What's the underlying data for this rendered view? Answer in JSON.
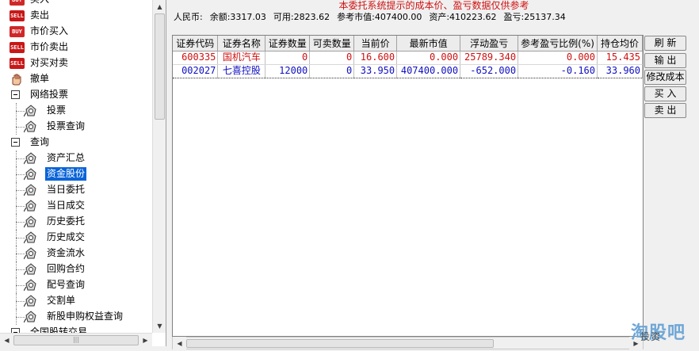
{
  "tree": {
    "items": [
      {
        "label": "买入",
        "icon": "buy-icon",
        "type": "trade"
      },
      {
        "label": "卖出",
        "icon": "sell-icon",
        "type": "trade"
      },
      {
        "label": "市价买入",
        "icon": "buy-icon",
        "type": "trade"
      },
      {
        "label": "市价卖出",
        "icon": "sell-icon",
        "type": "trade"
      },
      {
        "label": "对买对卖",
        "icon": "sell-icon",
        "type": "trade"
      },
      {
        "label": "撤单",
        "icon": "hand-icon",
        "type": "trade"
      },
      {
        "label": "网络投票",
        "icon": "collapse-icon",
        "type": "group"
      },
      {
        "label": "投票",
        "icon": "gear-icon",
        "type": "child"
      },
      {
        "label": "投票查询",
        "icon": "gear-icon",
        "type": "child"
      },
      {
        "label": "查询",
        "icon": "collapse-icon",
        "type": "group"
      },
      {
        "label": "资产汇总",
        "icon": "gear-icon",
        "type": "child"
      },
      {
        "label": "资金股份",
        "icon": "gear-icon",
        "type": "child",
        "selected": true
      },
      {
        "label": "当日委托",
        "icon": "gear-icon",
        "type": "child"
      },
      {
        "label": "当日成交",
        "icon": "gear-icon",
        "type": "child"
      },
      {
        "label": "历史委托",
        "icon": "gear-icon",
        "type": "child"
      },
      {
        "label": "历史成交",
        "icon": "gear-icon",
        "type": "child"
      },
      {
        "label": "资金流水",
        "icon": "gear-icon",
        "type": "child"
      },
      {
        "label": "回购合约",
        "icon": "gear-icon",
        "type": "child"
      },
      {
        "label": "配号查询",
        "icon": "gear-icon",
        "type": "child"
      },
      {
        "label": "交割单",
        "icon": "gear-icon",
        "type": "child"
      },
      {
        "label": "新股申购权益查询",
        "icon": "gear-icon",
        "type": "child"
      },
      {
        "label": "全国股转交易",
        "icon": "collapse-icon",
        "type": "group"
      }
    ]
  },
  "notice": "本委托系统提示的成本价、盈亏数据仅供参考",
  "summary": {
    "currency": "人民币:",
    "balance": "余额:3317.03",
    "available": "可用:2823.62",
    "market_value": "参考市值:407400.00",
    "assets": "资产:410223.62",
    "profit": "盈亏:25137.34"
  },
  "table": {
    "headers": [
      "证券代码",
      "证券名称",
      "证券数量",
      "可卖数量",
      "当前价",
      "最新市值",
      "浮动盈亏",
      "参考盈亏比例(%)",
      "持仓均价"
    ],
    "rows": [
      {
        "cells": [
          "600335",
          "国机汽车",
          "0",
          "0",
          "16.600",
          "0.000",
          "25789.340",
          "0.000",
          "15.435"
        ],
        "color": "#d01010"
      },
      {
        "cells": [
          "002027",
          "七喜控股",
          "12000",
          "0",
          "33.950",
          "407400.000",
          "-652.000",
          "-0.160",
          "33.960"
        ],
        "color": "#1010c0"
      }
    ]
  },
  "buttons": {
    "refresh": "刷 新",
    "export": "输 出",
    "modify_cost": "修改成本",
    "buy": "买 入",
    "sell": "卖 出"
  },
  "watermark": {
    "text": "淘股吧",
    "sub": "投资"
  },
  "icons": {
    "buy_badge": "BUY",
    "sell_badge": "SELL"
  }
}
